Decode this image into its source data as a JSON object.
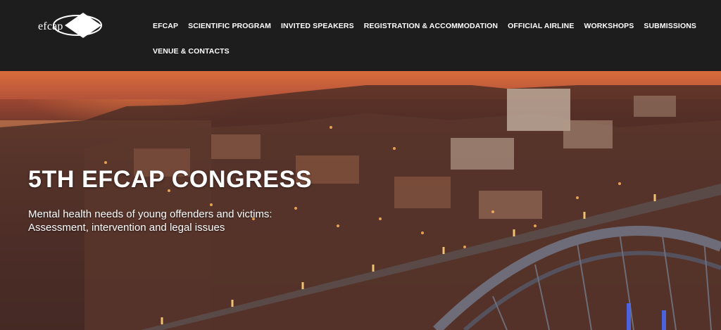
{
  "logo": {
    "text": "efcap"
  },
  "nav": {
    "items": [
      "EFCAP",
      "SCIENTIFIC PROGRAM",
      "INVITED SPEAKERS",
      "REGISTRATION & ACCOMMODATION",
      "OFFICIAL AIRLINE",
      "WORKSHOPS",
      "SUBMISSIONS",
      "VENUE & CONTACTS"
    ]
  },
  "hero": {
    "title": "5TH EFCAP CONGRESS",
    "subtitle_line1": "Mental health needs of young offenders and victims:",
    "subtitle_line2": "Assessment, intervention and legal issues"
  },
  "colors": {
    "header_bg": "#1d1d1d",
    "text": "#ffffff",
    "sunset": "#d86b3b"
  }
}
